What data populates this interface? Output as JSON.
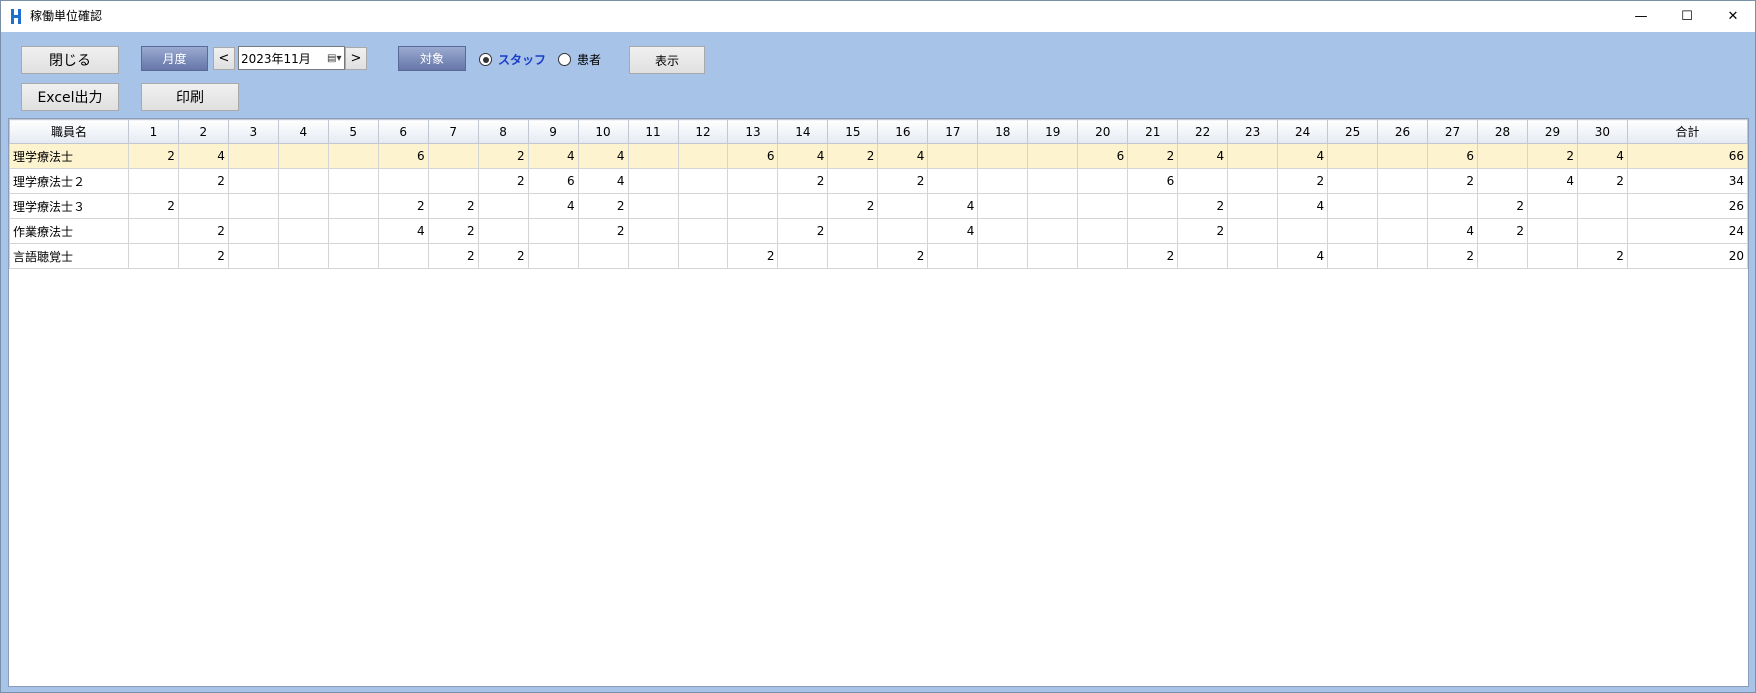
{
  "window": {
    "title": "稼働単位確認",
    "controls": {
      "minimize": "—",
      "maximize": "☐",
      "close": "✕"
    }
  },
  "toolbar": {
    "close_label": "閉じる",
    "excel_label": "Excel出力",
    "month_label": "月度",
    "prev_label": "<",
    "next_label": ">",
    "date_value": "2023年11月",
    "print_label": "印刷",
    "target_label": "対象",
    "radio_staff": "スタッフ",
    "radio_patient": "患者",
    "display_label": "表示"
  },
  "grid": {
    "name_header": "職員名",
    "total_header": "合計",
    "days": [
      "1",
      "2",
      "3",
      "4",
      "5",
      "6",
      "7",
      "8",
      "9",
      "10",
      "11",
      "12",
      "13",
      "14",
      "15",
      "16",
      "17",
      "18",
      "19",
      "20",
      "21",
      "22",
      "23",
      "24",
      "25",
      "26",
      "27",
      "28",
      "29",
      "30"
    ],
    "rows": [
      {
        "name": "理学療法士",
        "values": [
          "2",
          "4",
          "",
          "",
          "",
          "6",
          "",
          "2",
          "4",
          "4",
          "",
          "",
          "6",
          "4",
          "2",
          "4",
          "",
          "",
          "",
          "6",
          "2",
          "4",
          "",
          "4",
          "",
          "",
          "6",
          "",
          "2",
          "4"
        ],
        "total": "66",
        "selected": true
      },
      {
        "name": "理学療法士２",
        "values": [
          "",
          "2",
          "",
          "",
          "",
          "",
          "",
          "2",
          "6",
          "4",
          "",
          "",
          "",
          "2",
          "",
          "2",
          "",
          "",
          "",
          "",
          "6",
          "",
          "",
          "2",
          "",
          "",
          "2",
          "",
          "4",
          "2"
        ],
        "total": "34",
        "selected": false
      },
      {
        "name": "理学療法士３",
        "values": [
          "2",
          "",
          "",
          "",
          "",
          "2",
          "2",
          "",
          "4",
          "2",
          "",
          "",
          "",
          "",
          "2",
          "",
          "4",
          "",
          "",
          "",
          "",
          "2",
          "",
          "4",
          "",
          "",
          "",
          "2",
          "",
          ""
        ],
        "total": "26",
        "selected": false
      },
      {
        "name": "作業療法士",
        "values": [
          "",
          "2",
          "",
          "",
          "",
          "4",
          "2",
          "",
          "",
          "2",
          "",
          "",
          "",
          "2",
          "",
          "",
          "4",
          "",
          "",
          "",
          "",
          "2",
          "",
          "",
          "",
          "",
          "4",
          "2",
          "",
          ""
        ],
        "total": "24",
        "selected": false
      },
      {
        "name": "言語聴覚士",
        "values": [
          "",
          "2",
          "",
          "",
          "",
          "",
          "2",
          "2",
          "",
          "",
          "",
          "",
          "2",
          "",
          "",
          "2",
          "",
          "",
          "",
          "",
          "2",
          "",
          "",
          "4",
          "",
          "",
          "2",
          "",
          "",
          "2"
        ],
        "total": "20",
        "selected": false
      }
    ]
  }
}
